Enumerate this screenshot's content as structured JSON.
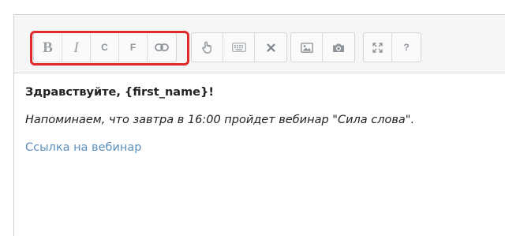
{
  "toolbar": {
    "format_group": [
      {
        "name": "bold-button",
        "glyph": "B",
        "icon": "bold-icon"
      },
      {
        "name": "italic-button",
        "glyph": "I",
        "icon": "italic-icon"
      },
      {
        "name": "c-button",
        "glyph": "C",
        "icon": "letter-c-icon"
      },
      {
        "name": "f-button",
        "glyph": "F",
        "icon": "letter-f-icon"
      },
      {
        "name": "link-button",
        "icon": "link-icon"
      }
    ],
    "insert_group": [
      {
        "name": "hand-pointer-button",
        "icon": "hand-pointer-icon"
      },
      {
        "name": "keyboard-button",
        "icon": "keyboard-icon"
      },
      {
        "name": "remove-button",
        "icon": "close-icon"
      }
    ],
    "media_group": [
      {
        "name": "image-button",
        "icon": "image-icon"
      },
      {
        "name": "camera-button",
        "icon": "camera-icon"
      }
    ],
    "view_group": [
      {
        "name": "fullscreen-button",
        "icon": "expand-icon"
      },
      {
        "name": "help-button",
        "glyph": "?",
        "icon": "help-icon"
      }
    ],
    "highlight_color": "#e02b2b"
  },
  "content": {
    "greeting": "Здравствуйте, {first_name}!",
    "reminder": "Напоминаем, что завтра в 16:00 пройдет вебинар \"Сила слова\".",
    "link_text": "Ссылка на вебинар",
    "link_color": "#5b8fbf"
  }
}
